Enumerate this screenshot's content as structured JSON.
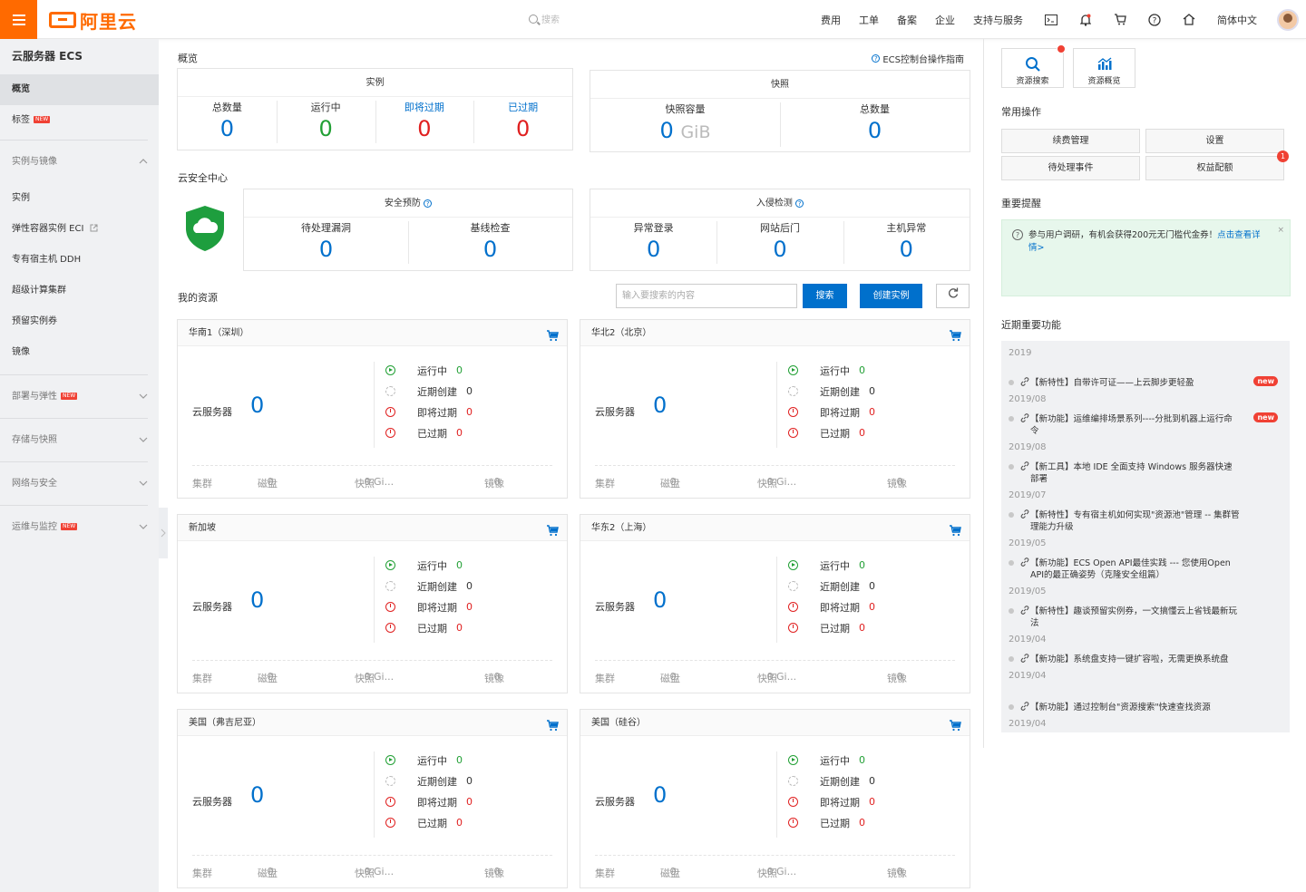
{
  "topbar": {
    "logo_text": "阿里云",
    "search_placeholder": "搜索",
    "nav": [
      "费用",
      "工单",
      "备案",
      "企业",
      "支持与服务"
    ],
    "icons": [
      "terminal-icon",
      "bell-icon",
      "cart-icon",
      "help-icon",
      "home-icon"
    ],
    "language": "简体中文"
  },
  "sidebar": {
    "title": "云服务器 ECS",
    "top_items": [
      {
        "label": "概览",
        "active": true
      },
      {
        "label": "标签",
        "new": true
      }
    ],
    "group_instances": {
      "label": "实例与镜像",
      "expanded": true
    },
    "instance_items": [
      "实例",
      "弹性容器实例 ECI",
      "专有宿主机 DDH",
      "超级计算集群",
      "预留实例券",
      "镜像"
    ],
    "groups": [
      {
        "label": "部署与弹性",
        "new": true
      },
      {
        "label": "存储与快照",
        "new": false
      },
      {
        "label": "网络与安全",
        "new": false
      },
      {
        "label": "运维与监控",
        "new": true
      }
    ],
    "new_badge": "NEW"
  },
  "main": {
    "overview_title": "概览",
    "help_link": "ECS控制台操作指南",
    "instance_card": {
      "title": "实例",
      "stats": [
        {
          "label": "总数量",
          "value": "0"
        },
        {
          "label": "运行中",
          "value": "0"
        },
        {
          "label": "即将过期",
          "value": "0"
        },
        {
          "label": "已过期",
          "value": "0"
        }
      ]
    },
    "snapshot_card": {
      "title": "快照",
      "stats": [
        {
          "label": "快照容量",
          "value": "0",
          "unit": "GiB"
        },
        {
          "label": "总数量",
          "value": "0"
        }
      ]
    },
    "security_title": "云安全中心",
    "prevention_card": {
      "title": "安全预防",
      "stats": [
        {
          "label": "待处理漏洞",
          "value": "0"
        },
        {
          "label": "基线检查",
          "value": "0"
        }
      ]
    },
    "intrusion_card": {
      "title": "入侵检测",
      "stats": [
        {
          "label": "异常登录",
          "value": "0"
        },
        {
          "label": "网站后门",
          "value": "0"
        },
        {
          "label": "主机异常",
          "value": "0"
        }
      ]
    },
    "resources_title": "我的资源",
    "search_placeholder": "输入要搜索的内容",
    "search_button": "搜索",
    "create_button": "创建实例",
    "regions": [
      {
        "name": "华南1（深圳）"
      },
      {
        "name": "华北2（北京）"
      },
      {
        "name": "新加坡"
      },
      {
        "name": "华东2（上海）"
      },
      {
        "name": "美国（弗吉尼亚）"
      },
      {
        "name": "美国（硅谷）"
      }
    ],
    "region_fields": {
      "server_label": "云服务器",
      "server_count": "0",
      "status": [
        {
          "label": "运行中",
          "value": "0",
          "tone": "green"
        },
        {
          "label": "近期创建",
          "value": "0",
          "tone": "gray"
        },
        {
          "label": "即将过期",
          "value": "0",
          "tone": "red"
        },
        {
          "label": "已过期",
          "value": "0",
          "tone": "red"
        }
      ],
      "footer": [
        {
          "label": "集群",
          "value": ""
        },
        {
          "label": "磁盘",
          "value": "0"
        },
        {
          "label": "快照",
          "value": "0 Gi..."
        },
        {
          "label": "镜像",
          "value": "0"
        }
      ]
    }
  },
  "right": {
    "quick": [
      {
        "label": "资源搜索",
        "icon": "search-icon"
      },
      {
        "label": "资源概览",
        "icon": "chart-icon"
      }
    ],
    "common_ops_title": "常用操作",
    "ops": [
      "续费管理",
      "设置",
      "待处理事件",
      "权益配额"
    ],
    "ops_badge": "1",
    "reminder_title": "重要提醒",
    "notice": {
      "text": "参与用户调研，有机会获得200元无门槛代金券！",
      "link": "点击查看详情>",
      "close": "×"
    },
    "recent_title": "近期重要功能",
    "year": "2019",
    "new_tag": "new",
    "features": [
      {
        "text": "【新特性】自带许可证——上云脚步更轻盈",
        "date": "2019/08",
        "new": true
      },
      {
        "text": "【新功能】运维编排场景系列----分批到机器上运行命令",
        "date": "2019/08",
        "new": true
      },
      {
        "text": "【新工具】本地 IDE 全面支持 Windows 服务器快速部署",
        "date": "2019/07",
        "new": false
      },
      {
        "text": "【新特性】专有宿主机如何实现\"资源池\"管理 -- 集群管理能力升级",
        "date": "2019/05",
        "new": false
      },
      {
        "text": "【新功能】ECS Open API最佳实践 --- 您使用Open API的最正确姿势（克隆安全组篇）",
        "date": "2019/05",
        "new": false
      },
      {
        "text": "【新特性】趣谈预留实例券，一文搞懂云上省钱最新玩法",
        "date": "2019/04",
        "new": false
      },
      {
        "text": "【新功能】系统盘支持一键扩容啦，无需更换系统盘",
        "date": "2019/04",
        "new": false
      },
      {
        "text": "【新功能】通过控制台\"资源搜索\"快速查找资源",
        "date": "2019/04",
        "new": false
      }
    ]
  },
  "colors": {
    "brand_orange": "#ff6a00",
    "primary_blue": "#0070cc",
    "green": "#22a035",
    "red": "#e02020"
  }
}
